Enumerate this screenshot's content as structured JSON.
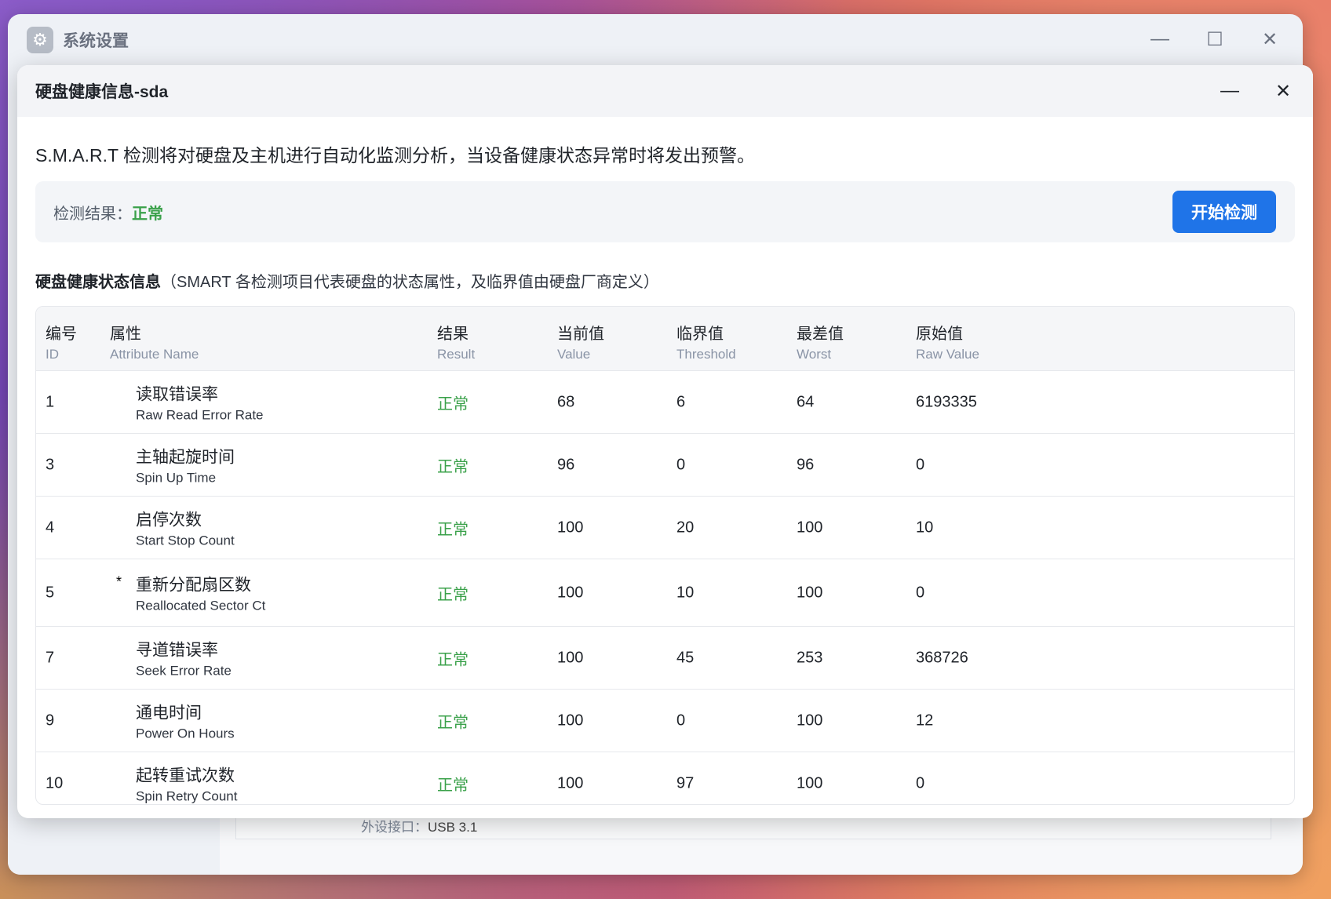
{
  "window": {
    "title": "系统设置",
    "icon": "gear-icon"
  },
  "background": {
    "port_label": "外设接口：",
    "port_value": "USB 3.1"
  },
  "dialog": {
    "title": "硬盘健康信息-sda",
    "description": "S.M.A.R.T 检测将对硬盘及主机进行自动化监测分析，当设备健康状态异常时将发出预警。",
    "result_label": "检测结果：",
    "result_value": "正常",
    "start_button": "开始检测",
    "section_title": "硬盘健康状态信息",
    "section_note": "（SMART 各检测项目代表硬盘的状态属性，及临界值由硬盘厂商定义）"
  },
  "table": {
    "headers": [
      {
        "cn": "编号",
        "en": "ID"
      },
      {
        "cn": "属性",
        "en": "Attribute Name"
      },
      {
        "cn": "结果",
        "en": "Result"
      },
      {
        "cn": "当前值",
        "en": "Value"
      },
      {
        "cn": "临界值",
        "en": "Threshold"
      },
      {
        "cn": "最差值",
        "en": "Worst"
      },
      {
        "cn": "原始值",
        "en": "Raw Value"
      }
    ],
    "rows": [
      {
        "id": "1",
        "star": "",
        "name_cn": "读取错误率",
        "name_en": "Raw Read Error Rate",
        "result": "正常",
        "value": "68",
        "threshold": "6",
        "worst": "64",
        "raw": "6193335"
      },
      {
        "id": "3",
        "star": "",
        "name_cn": "主轴起旋时间",
        "name_en": "Spin Up Time",
        "result": "正常",
        "value": "96",
        "threshold": "0",
        "worst": "96",
        "raw": "0"
      },
      {
        "id": "4",
        "star": "",
        "name_cn": "启停次数",
        "name_en": "Start Stop Count",
        "result": "正常",
        "value": "100",
        "threshold": "20",
        "worst": "100",
        "raw": "10"
      },
      {
        "id": "5",
        "star": "*",
        "name_cn": "重新分配扇区数",
        "name_en": "Reallocated Sector Ct",
        "result": "正常",
        "value": "100",
        "threshold": "10",
        "worst": "100",
        "raw": "0"
      },
      {
        "id": "7",
        "star": "",
        "name_cn": "寻道错误率",
        "name_en": "Seek Error Rate",
        "result": "正常",
        "value": "100",
        "threshold": "45",
        "worst": "253",
        "raw": "368726"
      },
      {
        "id": "9",
        "star": "",
        "name_cn": "通电时间",
        "name_en": "Power On Hours",
        "result": "正常",
        "value": "100",
        "threshold": "0",
        "worst": "100",
        "raw": "12"
      },
      {
        "id": "10",
        "star": "",
        "name_cn": "起转重试次数",
        "name_en": "Spin Retry Count",
        "result": "正常",
        "value": "100",
        "threshold": "97",
        "worst": "100",
        "raw": "0"
      }
    ]
  },
  "colors": {
    "accent": "#1f74e8",
    "ok": "#3aa14a"
  }
}
